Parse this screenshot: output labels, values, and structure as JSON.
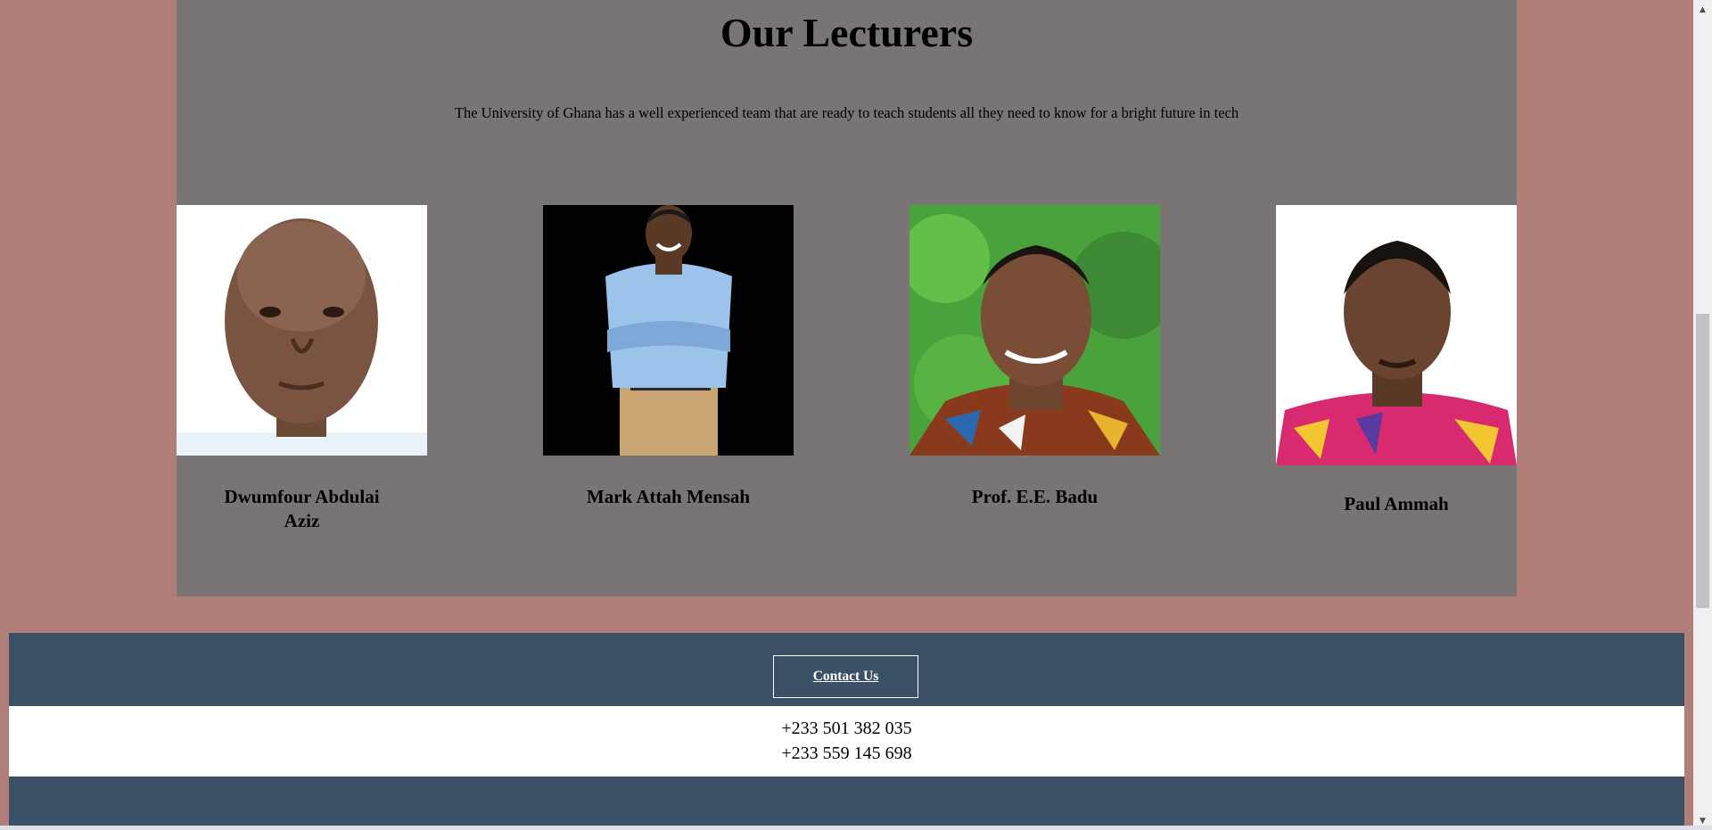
{
  "lecturers": {
    "title": "Our Lecturers",
    "intro": "The University of Ghana has a well experienced team that are ready to teach students all they need to know for a bright future in tech",
    "people": [
      {
        "name_line1": "Dwumfour Abdulai",
        "name_line2": "Aziz"
      },
      {
        "name_line1": "Mark Attah Mensah",
        "name_line2": ""
      },
      {
        "name_line1": "Prof. E.E. Badu",
        "name_line2": ""
      },
      {
        "name_line1": "Paul Ammah",
        "name_line2": ""
      }
    ]
  },
  "footer": {
    "contact_label": "Contact Us",
    "phone_1": "+233 501 382 035",
    "phone_2": "+233 559 145 698"
  },
  "colors": {
    "page_bg": "#b07f7a",
    "section_bg": "#7a7575",
    "footer_bg": "#3a5064"
  },
  "icons": {
    "scroll_up": "scroll-up-arrow-icon",
    "scroll_down": "scroll-down-arrow-icon"
  }
}
